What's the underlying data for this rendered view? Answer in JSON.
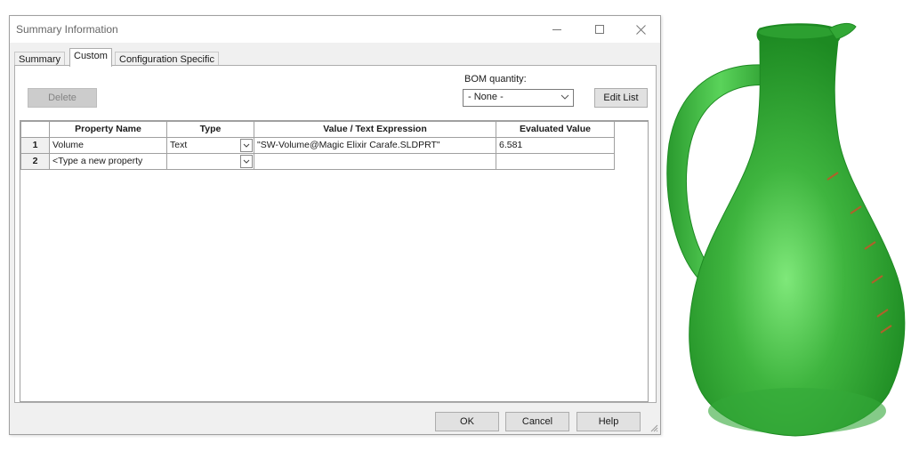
{
  "window": {
    "title": "Summary Information",
    "controls": {
      "minimize": "minimize-icon",
      "maximize": "maximize-icon",
      "close": "close-icon"
    }
  },
  "tabs": [
    {
      "label": "Summary",
      "active": false
    },
    {
      "label": "Custom",
      "active": true
    },
    {
      "label": "Configuration Specific",
      "active": false
    }
  ],
  "toolbar": {
    "delete_label": "Delete",
    "bom_label": "BOM quantity:",
    "bom_value": "- None -",
    "edit_list_label": "Edit List"
  },
  "grid": {
    "columns": [
      "Property Name",
      "Type",
      "Value / Text Expression",
      "Evaluated Value"
    ],
    "rows": [
      {
        "num": "1",
        "property": "Volume",
        "type": "Text",
        "value": "\"SW-Volume@Magic Elixir Carafe.SLDPRT\"",
        "evaluated": "6.581"
      },
      {
        "num": "2",
        "property": "<Type a new property",
        "type": "",
        "value": "",
        "evaluated": ""
      }
    ]
  },
  "footer": {
    "ok_label": "OK",
    "cancel_label": "Cancel",
    "help_label": "Help"
  },
  "colors": {
    "carafe_green": "#3fb53f",
    "carafe_dark": "#1f8a24",
    "tick_marks": "#b0602a"
  },
  "image": {
    "name": "carafe-model-render"
  }
}
